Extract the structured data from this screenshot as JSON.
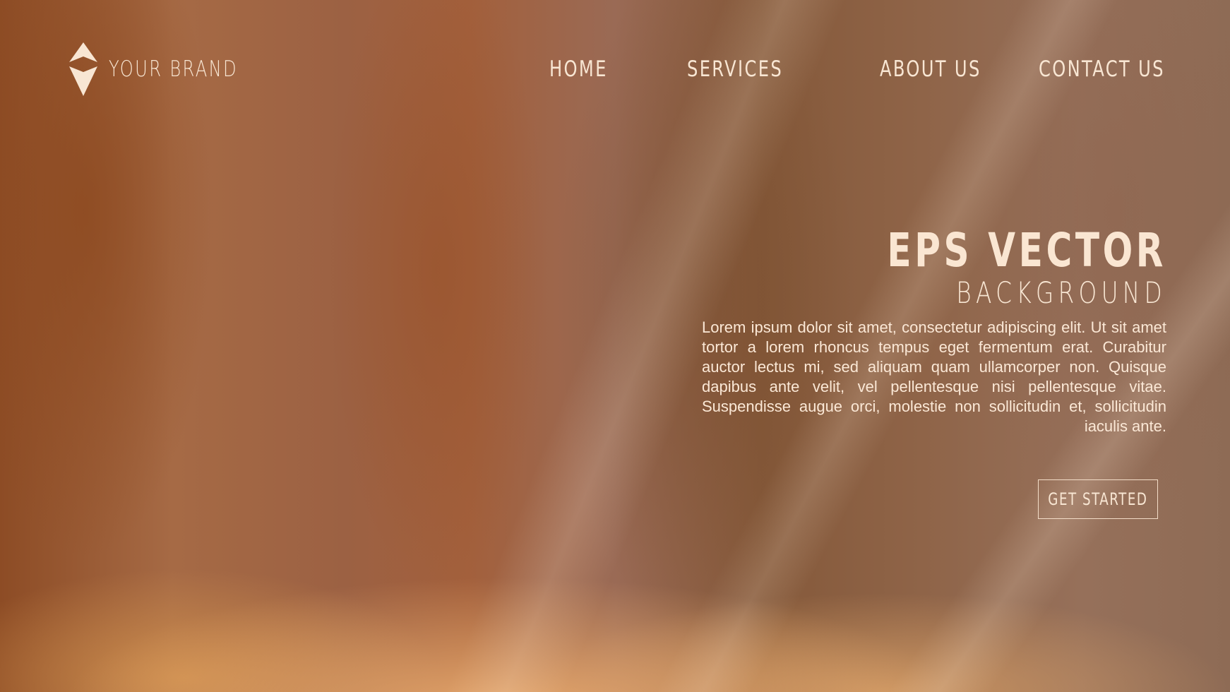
{
  "brand": {
    "name": "YOUR BRAND",
    "logo_icon": "diamond-logo-icon"
  },
  "nav": {
    "items": [
      "HOME",
      "SERVICES",
      "ABOUT US",
      "CONTACT US"
    ]
  },
  "hero": {
    "title": "EPS VECTOR",
    "subtitle": "BACKGROUND",
    "body": "Lorem ipsum dolor sit amet, consectetur adipiscing elit. Ut sit amet tortor a lorem rhoncus tempus eget fermentum erat. Curabitur auctor lectus mi, sed aliquam quam ullamcorper non. Quisque dapibus ante velit, vel pellentesque nisi pellentesque vitae. Suspendisse augue orci, molestie non sollicitudin et, sollicitudin iaculis ante.",
    "cta_label": "GET STARTED"
  },
  "colors": {
    "text": "#f8e6d3",
    "background_dark": "#8d4c25",
    "background_glow": "#e8aa6e"
  }
}
